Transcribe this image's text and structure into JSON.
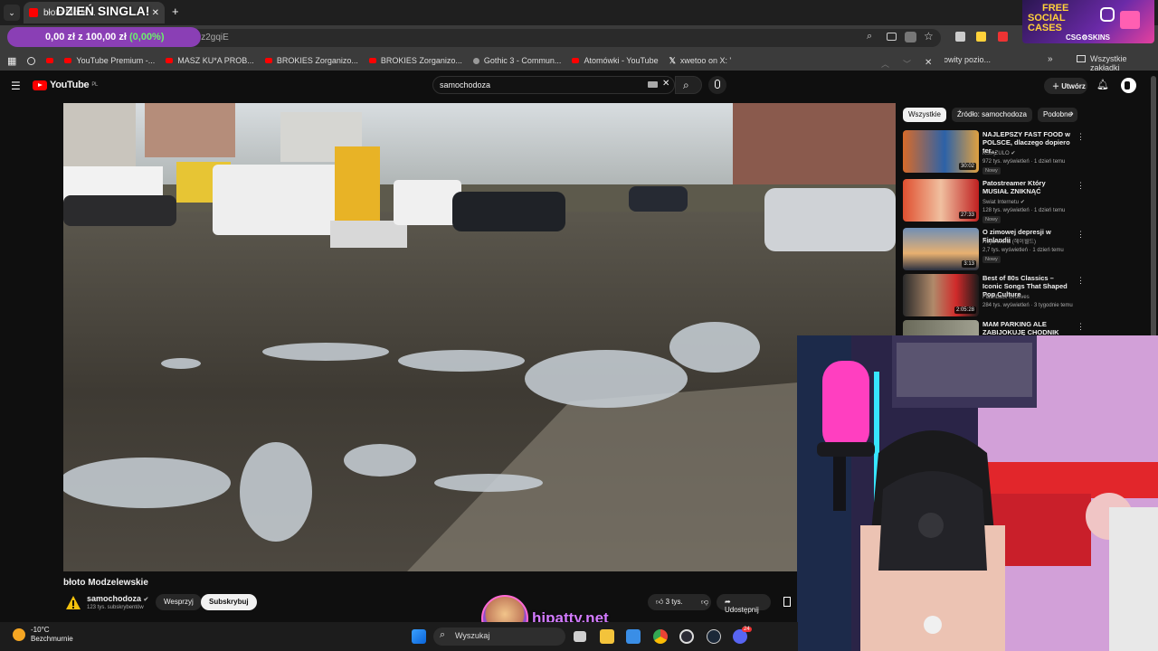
{
  "browser": {
    "active_tab_title": "błoto Mode...",
    "new_tab_symbol": "+",
    "url_fragment": "Dz2gqiE",
    "bookmarks": [
      {
        "label": "YouTube Premium -..."
      },
      {
        "label": "MASZ KU*A PROB..."
      },
      {
        "label": "BROKIES Zorganizo..."
      },
      {
        "label": "BROKIES Zorganizo..."
      },
      {
        "label": "Gothic 3 - Commun..."
      },
      {
        "label": "Atomówki - YouTube"
      },
      {
        "label": "xwetoo on X: \"Mati..."
      }
    ],
    "bookmark_partial": "owity pozio...",
    "all_bookmarks": "Wszystkie zakładki"
  },
  "overlay": {
    "sale_banner": "DZIEŃ SINGLA!",
    "balance_prefix": "0,00 zł",
    "balance_sep": "z",
    "balance_goal": "100,00 zł",
    "balance_pct": "(0,00%)",
    "ad_line1": "FREE",
    "ad_line2": "SOCIAL",
    "ad_line3": "CASES",
    "ad_brand": "CSG⚙SKINS",
    "stream_site": "hipatty.net"
  },
  "youtube": {
    "logo": "YouTube",
    "region": "PL",
    "search_value": "samochodoza",
    "create_label": "Utwórz",
    "video": {
      "title": "błoto Modzelewskie",
      "channel": "samochodoza",
      "subscribers": "123 tys. subskrybentów",
      "support_label": "Wesprzyj",
      "subscribe_label": "Subskrybuj",
      "likes": "3 tys.",
      "share_label": "Udostępnij"
    },
    "chips": [
      "Wszystkie",
      "Źródło: samochodoza",
      "Podobne"
    ],
    "recommendations": [
      {
        "title": "NAJLEPSZY FAST FOOD w POLSCE, dlaczego dopiero ter...",
        "channel": "KSIĄŻULO ✔",
        "meta": "972 tys. wyświetleń · 1 dzień temu",
        "duration": "30:02",
        "badge": "Nowy"
      },
      {
        "title": "Patostreamer Który MUSIAŁ ZNIKNĄĆ",
        "channel": "Świat Internetu ✔",
        "meta": "128 tys. wyświetleń · 1 dzień temu",
        "duration": "27:33",
        "badge": "Nowy"
      },
      {
        "title": "O zimowej depresji w Finlandii",
        "channel": "Heya World (헤이월드)",
        "meta": "2,7 tys. wyświetleń · 1 dzień temu",
        "duration": "3:13",
        "badge": "Nowy"
      },
      {
        "title": "Best of 80s Classics – Iconic Songs That Shaped Pop Culture",
        "channel": "Flashback Grooves",
        "meta": "284 tys. wyświetleń · 3 tygodnie temu",
        "duration": "2:05:28",
        "badge": ""
      },
      {
        "title": "MAM PARKING ALE ZABIJOKUJĘ CHODNIK LOĆ 1",
        "channel": "",
        "meta": "",
        "duration": "",
        "badge": ""
      }
    ]
  },
  "taskbar": {
    "temperature": "-10°C",
    "weather": "Bezchmurnie",
    "search_placeholder": "Wyszukaj",
    "notification_badge": "24"
  },
  "colors": {
    "accent": "#ff0000",
    "brand_purple": "#8a3fb5",
    "neon": "#ff6ad5"
  }
}
